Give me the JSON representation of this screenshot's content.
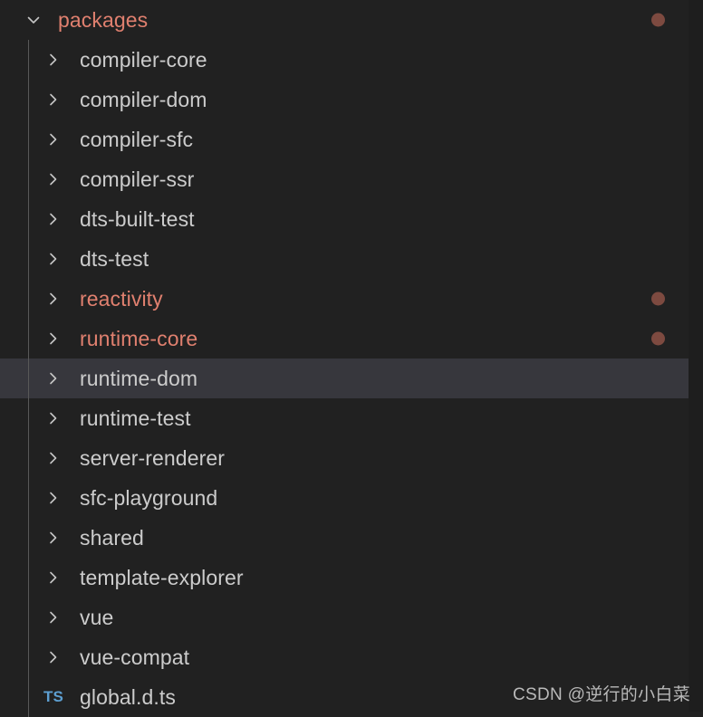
{
  "explorer": {
    "colors": {
      "background": "#212121",
      "selected_row": "#37373d",
      "label": "#cccccc",
      "modified_label": "#e0806f",
      "status_dot": "#7d4a40",
      "indent_guide": "#585858",
      "ts_icon": "#5d9fd1",
      "gutter": "#1e1e1e"
    },
    "root": {
      "name": "packages",
      "chevron_icon": "chevron-down-icon",
      "expanded": true,
      "modified": true,
      "has_status_dot": true
    },
    "items": [
      {
        "name": "compiler-core",
        "icon": "chevron-right-icon",
        "type": "folder",
        "modified": false,
        "has_status_dot": false,
        "selected": false
      },
      {
        "name": "compiler-dom",
        "icon": "chevron-right-icon",
        "type": "folder",
        "modified": false,
        "has_status_dot": false,
        "selected": false
      },
      {
        "name": "compiler-sfc",
        "icon": "chevron-right-icon",
        "type": "folder",
        "modified": false,
        "has_status_dot": false,
        "selected": false
      },
      {
        "name": "compiler-ssr",
        "icon": "chevron-right-icon",
        "type": "folder",
        "modified": false,
        "has_status_dot": false,
        "selected": false
      },
      {
        "name": "dts-built-test",
        "icon": "chevron-right-icon",
        "type": "folder",
        "modified": false,
        "has_status_dot": false,
        "selected": false
      },
      {
        "name": "dts-test",
        "icon": "chevron-right-icon",
        "type": "folder",
        "modified": false,
        "has_status_dot": false,
        "selected": false
      },
      {
        "name": "reactivity",
        "icon": "chevron-right-icon",
        "type": "folder",
        "modified": true,
        "has_status_dot": true,
        "selected": false
      },
      {
        "name": "runtime-core",
        "icon": "chevron-right-icon",
        "type": "folder",
        "modified": true,
        "has_status_dot": true,
        "selected": false
      },
      {
        "name": "runtime-dom",
        "icon": "chevron-right-icon",
        "type": "folder",
        "modified": false,
        "has_status_dot": false,
        "selected": true
      },
      {
        "name": "runtime-test",
        "icon": "chevron-right-icon",
        "type": "folder",
        "modified": false,
        "has_status_dot": false,
        "selected": false
      },
      {
        "name": "server-renderer",
        "icon": "chevron-right-icon",
        "type": "folder",
        "modified": false,
        "has_status_dot": false,
        "selected": false
      },
      {
        "name": "sfc-playground",
        "icon": "chevron-right-icon",
        "type": "folder",
        "modified": false,
        "has_status_dot": false,
        "selected": false
      },
      {
        "name": "shared",
        "icon": "chevron-right-icon",
        "type": "folder",
        "modified": false,
        "has_status_dot": false,
        "selected": false
      },
      {
        "name": "template-explorer",
        "icon": "chevron-right-icon",
        "type": "folder",
        "modified": false,
        "has_status_dot": false,
        "selected": false
      },
      {
        "name": "vue",
        "icon": "chevron-right-icon",
        "type": "folder",
        "modified": false,
        "has_status_dot": false,
        "selected": false
      },
      {
        "name": "vue-compat",
        "icon": "chevron-right-icon",
        "type": "folder",
        "modified": false,
        "has_status_dot": false,
        "selected": false
      },
      {
        "name": "global.d.ts",
        "icon": "typescript-file-icon",
        "type": "file",
        "badge": "TS",
        "modified": false,
        "has_status_dot": false,
        "selected": false
      }
    ]
  },
  "watermark": {
    "text": "CSDN @逆行的小白菜"
  }
}
